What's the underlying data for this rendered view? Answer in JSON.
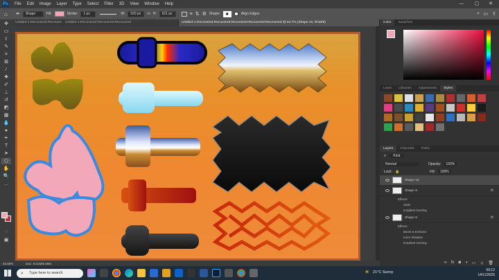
{
  "menu": {
    "logo": "Ps",
    "items": [
      "File",
      "Edit",
      "Image",
      "Layer",
      "Type",
      "Select",
      "Filter",
      "3D",
      "View",
      "Window",
      "Help"
    ],
    "minimize": "—",
    "maximize": "▢",
    "close": "✕"
  },
  "options": {
    "tool_mode": "Shape",
    "fill_label": "Fill:",
    "stroke_label": "Stroke:",
    "stroke_width": "1 px",
    "w_label": "W:",
    "w_value": "520 px",
    "h_label": "H:",
    "h_value": "621 px",
    "shape_label": "Shape:",
    "align_edges": "Align Edges"
  },
  "tabs": [
    "Untitled-1-Recovered-Recovered",
    "Untitled-1-Recovered-Recovered-Recovered",
    "Untitled-1-Recovered-Recovered-Recovered-Recovered-Recovered @ 53.7% (Shape 10, RGB/8)"
  ],
  "status": {
    "zoom": "53.68%",
    "doc": "Doc: 9.01M/8.06M"
  },
  "color_panel": {
    "tabs": [
      "Color",
      "Swatches"
    ]
  },
  "learn_panel": {
    "tabs": [
      "Learn",
      "Libraries",
      "Adjustments",
      "Styles"
    ]
  },
  "layers_panel": {
    "tabs": [
      "Layers",
      "Channels",
      "Paths"
    ],
    "kind": "Kind",
    "blend_mode": "Normal",
    "opacity_label": "Opacity:",
    "opacity_value": "100%",
    "lock_label": "Lock:",
    "fill_label": "Fill:",
    "fill_value": "100%",
    "layers": [
      {
        "name": "Shape 10",
        "fx": ""
      },
      {
        "name": "Shape 9",
        "fx": "fx"
      },
      {
        "name": "Shape 8",
        "fx": "fx"
      }
    ],
    "shape9_effects": {
      "title": "Effects",
      "items": [
        "Satin",
        "Gradient Overlay"
      ]
    },
    "shape8_effects": {
      "title": "Effects",
      "items": [
        "Bevel & Emboss",
        "Inner Shadow",
        "Gradient Overlay"
      ]
    }
  },
  "taskbar": {
    "search_placeholder": "Type here to search",
    "weather": "21°C  Sunny",
    "time": "09:12",
    "date": "14/11/2025"
  },
  "colors": {
    "doc_border": "#b35a2a",
    "accent_swatch": "#f4a6b6"
  }
}
